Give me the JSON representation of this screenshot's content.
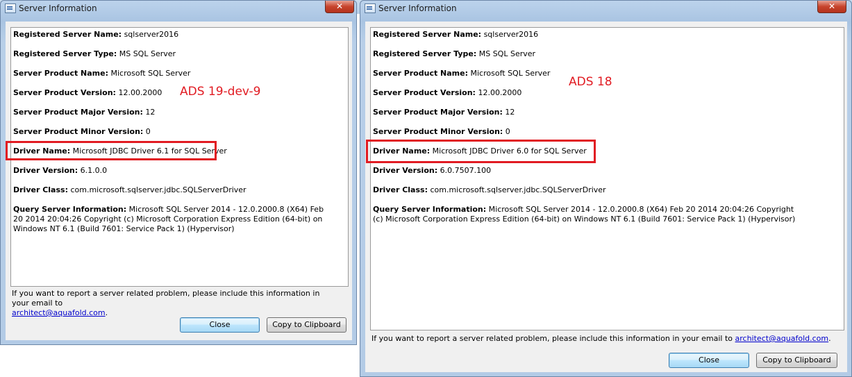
{
  "windows": {
    "left": {
      "title": "Server Information",
      "close_glyph": "✕",
      "annotation": "ADS 19-dev-9",
      "fields": [
        {
          "label": "Registered Server Name:",
          "value": " sqlserver2016"
        },
        {
          "label": "Registered Server Type:",
          "value": " MS SQL Server"
        },
        {
          "label": "Server Product Name:",
          "value": " Microsoft SQL Server"
        },
        {
          "label": "Server Product Version:",
          "value": " 12.00.2000"
        },
        {
          "label": "Server Product Major Version:",
          "value": " 12"
        },
        {
          "label": "Server Product Minor Version:",
          "value": " 0"
        },
        {
          "label": "Driver Name:",
          "value": " Microsoft JDBC Driver 6.1 for SQL Server"
        },
        {
          "label": "Driver Version:",
          "value": " 6.1.0.0"
        },
        {
          "label": "Driver Class:",
          "value": " com.microsoft.sqlserver.jdbc.SQLServerDriver"
        },
        {
          "label": "Query Server Information:",
          "value": " Microsoft SQL Server 2014 - 12.0.2000.8 (X64) Feb 20 2014 20:04:26 Copyright (c) Microsoft Corporation Express Edition (64-bit) on Windows NT 6.1  (Build 7601: Service Pack 1) (Hypervisor)"
        }
      ],
      "note_text": "If you want to report a server related problem, please include this information in your email to",
      "note_email": "architect@aquafold.com",
      "note_end": ".",
      "close_button": "Close",
      "copy_button": "Copy to Clipboard"
    },
    "right": {
      "title": "Server Information",
      "close_glyph": "✕",
      "annotation": "ADS 18",
      "fields": [
        {
          "label": "Registered Server Name:",
          "value": " sqlserver2016"
        },
        {
          "label": "Registered Server Type:",
          "value": " MS SQL Server"
        },
        {
          "label": "Server Product Name:",
          "value": " Microsoft SQL Server"
        },
        {
          "label": "Server Product Version:",
          "value": " 12.00.2000"
        },
        {
          "label": "Server Product Major Version:",
          "value": " 12"
        },
        {
          "label": "Server Product Minor Version:",
          "value": " 0"
        },
        {
          "label": "Driver Name:",
          "value": " Microsoft JDBC Driver 6.0 for SQL Server"
        },
        {
          "label": "Driver Version:",
          "value": " 6.0.7507.100"
        },
        {
          "label": "Driver Class:",
          "value": " com.microsoft.sqlserver.jdbc.SQLServerDriver"
        },
        {
          "label": "Query Server Information:",
          "value": " Microsoft SQL Server 2014 - 12.0.2000.8 (X64) Feb 20 2014 20:04:26 Copyright (c) Microsoft Corporation Express Edition (64-bit) on Windows NT 6.1  (Build 7601: Service Pack 1) (Hypervisor)"
        }
      ],
      "note_text": "If you want to report a server related problem, please include this information in your email to",
      "note_email": "architect@aquafold.com",
      "note_end": ".",
      "close_button": "Close",
      "copy_button": "Copy to Clipboard"
    }
  },
  "colors": {
    "highlight": "#e11b22",
    "link": "#0000cc"
  },
  "icons": {
    "window_icon": "server-info-window-icon",
    "close": "close-x-icon"
  }
}
